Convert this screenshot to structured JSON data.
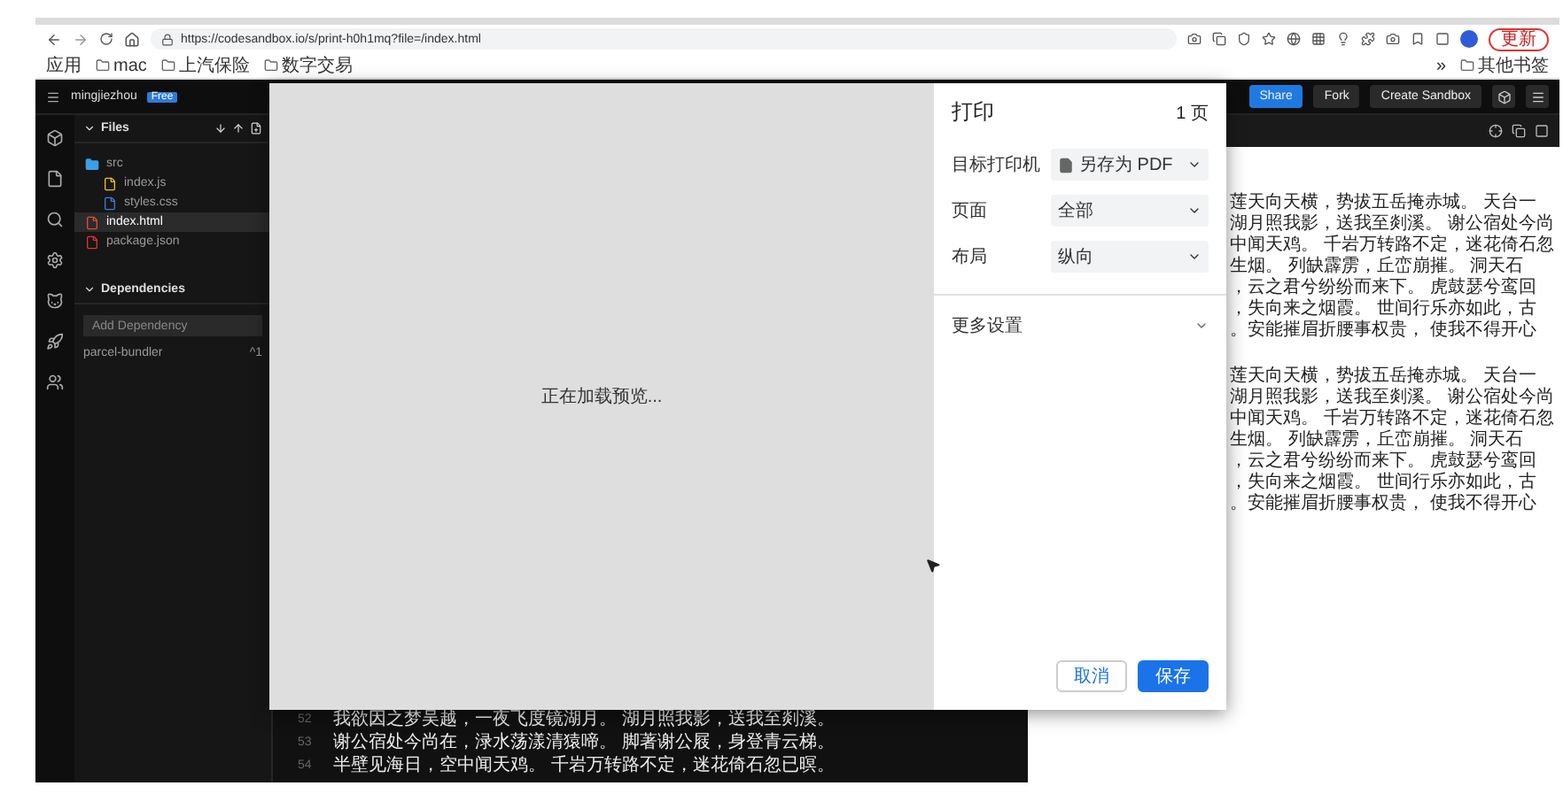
{
  "browser": {
    "address": "https://codesandbox.io/s/print-h0h1mq?file=/index.html",
    "update_button": "更新",
    "bookmarks": [
      "应用",
      "mac",
      "上汽保险",
      "数字交易"
    ],
    "bookmarks_right": [
      "»",
      "其他书签"
    ]
  },
  "sandbox": {
    "user": "mingjiezhou",
    "plan_badge": "Free",
    "files_title": "Files",
    "files": [
      {
        "name": "src",
        "kind": "folder",
        "selected": false,
        "children": [
          {
            "name": "index.js",
            "kind": "js",
            "selected": false
          },
          {
            "name": "styles.css",
            "kind": "css",
            "selected": false
          }
        ]
      },
      {
        "name": "index.html",
        "kind": "html",
        "selected": true
      },
      {
        "name": "package.json",
        "kind": "json",
        "selected": false
      }
    ],
    "dependencies_title": "Dependencies",
    "dependency_search": {
      "placeholder": "Add Dependency"
    },
    "dependencies": [
      {
        "name": "parcel-bundler",
        "version": "^1"
      }
    ],
    "header_buttons": [
      {
        "label": "Share",
        "primary": true
      },
      {
        "label": "Fork",
        "primary": false
      },
      {
        "label": "Create Sandbox",
        "primary": false
      }
    ],
    "code_lines": [
      {
        "number": "52",
        "text": "我欲因之梦吴越，一夜飞度镜湖月。 湖月照我影，送我至剡溪。"
      },
      {
        "number": "53",
        "text": "谢公宿处今尚在，渌水荡漾清猿啼。 脚著谢公屐，身登青云梯。"
      },
      {
        "number": "54",
        "text": "半壁见海日，空中闻天鸡。 千岩万转路不定，迷花倚石忽已暝。"
      }
    ],
    "preview_paragraphs": [
      [
        "莲天向天横，势拔五岳掩赤城。 天台一",
        "湖月照我影，送我至剡溪。 谢公宿处今尚",
        "中闻天鸡。 千岩万转路不定，迷花倚石忽",
        "生烟。 列缺霹雳，丘峦崩摧。 洞天石",
        "，云之君兮纷纷而来下。 虎鼓瑟兮鸾回",
        "，失向来之烟霞。 世间行乐亦如此，古",
        "。安能摧眉折腰事权贵， 使我不得开心"
      ],
      [
        "莲天向天横，势拔五岳掩赤城。 天台一",
        "湖月照我影，送我至剡溪。 谢公宿处今尚",
        "中闻天鸡。 千岩万转路不定，迷花倚石忽",
        "生烟。 列缺霹雳，丘峦崩摧。 洞天石",
        "，云之君兮纷纷而来下。 虎鼓瑟兮鸾回",
        "，失向来之烟霞。 世间行乐亦如此，古",
        "。安能摧眉折腰事权贵， 使我不得开心"
      ]
    ]
  },
  "print_dialog": {
    "title": "打印",
    "page_count": "1 页",
    "loading": "正在加载预览...",
    "settings": [
      {
        "label": "目标打印机",
        "value": "另存为 PDF",
        "has_icon": true
      },
      {
        "label": "页面",
        "value": "全部",
        "has_icon": false
      },
      {
        "label": "布局",
        "value": "纵向",
        "has_icon": false
      }
    ],
    "more_settings": "更多设置",
    "buttons": [
      {
        "label": "取消",
        "primary": false
      },
      {
        "label": "保存",
        "primary": true
      }
    ]
  }
}
